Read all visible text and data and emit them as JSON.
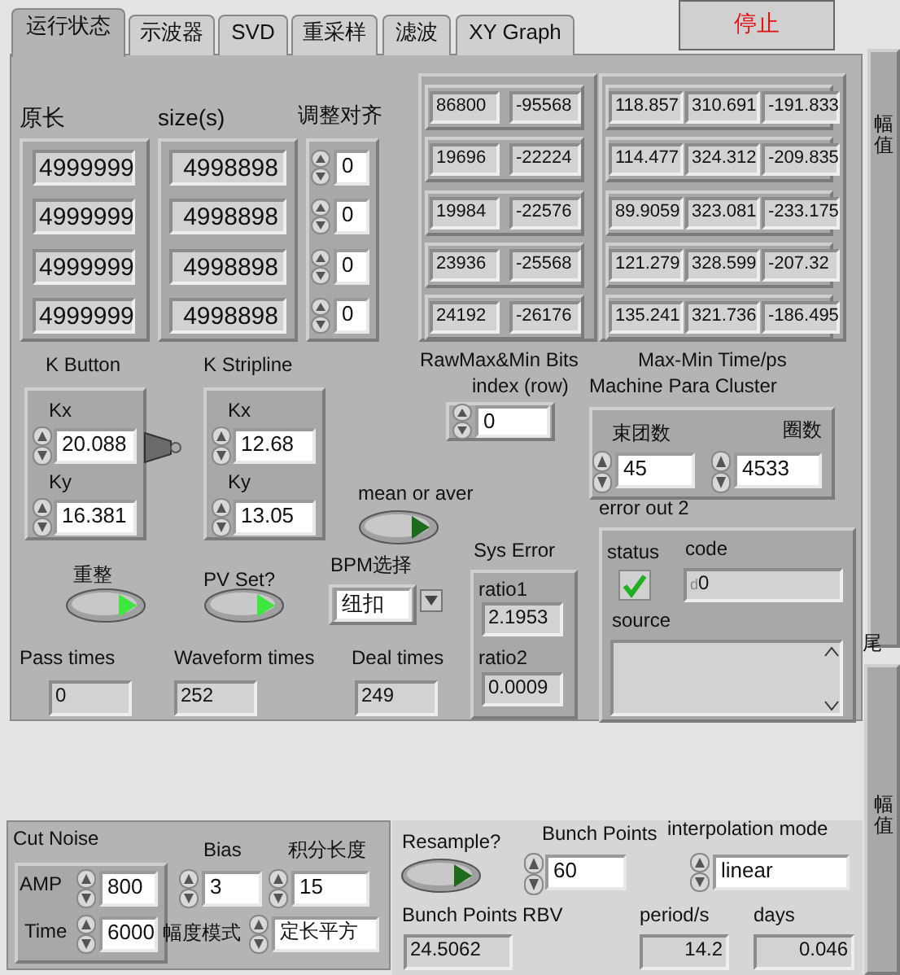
{
  "stop_button": {
    "label": "停止"
  },
  "tabs": [
    {
      "label": "运行状态",
      "selected": true
    },
    {
      "label": "示波器",
      "selected": false
    },
    {
      "label": "SVD",
      "selected": false
    },
    {
      "label": "重采样",
      "selected": false
    },
    {
      "label": "滤波",
      "selected": false
    },
    {
      "label": "XY Graph",
      "selected": false
    }
  ],
  "side_labels": [
    {
      "text": "幅值"
    },
    {
      "text": "尾"
    },
    {
      "text": "幅值"
    }
  ],
  "length_columns": [
    {
      "label": "原长",
      "values": [
        "4999999",
        "4999999",
        "4999999",
        "4999999"
      ]
    },
    {
      "label": "size(s)",
      "values": [
        "4998898",
        "4998898",
        "4998898",
        "4998898"
      ]
    }
  ],
  "align": {
    "label": "调整对齐",
    "values": [
      "0",
      "0",
      "0",
      "0"
    ]
  },
  "rawmax": {
    "label": "RawMax&Min Bits",
    "rows": [
      [
        "86800",
        "-95568"
      ],
      [
        "19696",
        "-22224"
      ],
      [
        "19984",
        "-22576"
      ],
      [
        "23936",
        "-25568"
      ],
      [
        "24192",
        "-26176"
      ]
    ]
  },
  "maxmin": {
    "label": "Max-Min Time/ps",
    "rows": [
      [
        "118.857",
        "310.691",
        "-191.833"
      ],
      [
        "114.477",
        "324.312",
        "-209.835"
      ],
      [
        "89.9059",
        "323.081",
        "-233.175"
      ],
      [
        "121.279",
        "328.599",
        "-207.32"
      ],
      [
        "135.241",
        "321.736",
        "-186.495"
      ]
    ]
  },
  "index": {
    "label": "index (row)",
    "value": "0"
  },
  "k_clusters": [
    {
      "title": "K Button",
      "kx_label": "Kx",
      "kx": "20.088",
      "ky_label": "Ky",
      "ky": "16.381"
    },
    {
      "title": "K Stripline",
      "kx_label": "Kx",
      "kx": "12.68",
      "ky_label": "Ky",
      "ky": "13.05"
    }
  ],
  "machine_para": {
    "title": "Machine Para Cluster",
    "bunches_label": "束团数",
    "bunches": "45",
    "turns_label": "圈数",
    "turns": "4533"
  },
  "error_out": {
    "title": "error out 2",
    "status_label": "status",
    "status": true,
    "code_label": "code",
    "code_prefix": "d",
    "code": "0",
    "source_label": "source"
  },
  "switches": [
    {
      "label": "mean or aver",
      "on": false
    },
    {
      "label": "重整",
      "on": true
    },
    {
      "label": "PV Set?",
      "on": true
    },
    {
      "label": "Resample?",
      "on": false
    }
  ],
  "bpm": {
    "label": "BPM选择",
    "value": "纽扣"
  },
  "sys_error": {
    "title": "Sys Error",
    "ratio1_label": "ratio1",
    "ratio1": "2.1953",
    "ratio2_label": "ratio2",
    "ratio2": "0.0009"
  },
  "counters": [
    {
      "label": "Pass times",
      "value": "0"
    },
    {
      "label": "Waveform times",
      "value": "252"
    },
    {
      "label": "Deal times",
      "value": "249"
    }
  ],
  "cut_noise": {
    "title": "Cut Noise",
    "amp_label": "AMP",
    "amp": "800",
    "time_label": "Time",
    "time": "6000"
  },
  "bias": {
    "label": "Bias",
    "value": "3"
  },
  "integral_length": {
    "label": "积分长度",
    "value": "15"
  },
  "amp_mode": {
    "label": "幅度模式",
    "value": "定长平方"
  },
  "bunch_points": {
    "label": "Bunch Points",
    "value": "60"
  },
  "interpolation": {
    "label": "interpolation mode",
    "value": "linear"
  },
  "readbacks": [
    {
      "label": "Bunch Points RBV",
      "value": "24.5062"
    },
    {
      "label": "period/s",
      "value": "14.2"
    },
    {
      "label": "days",
      "value": "0.046"
    }
  ]
}
